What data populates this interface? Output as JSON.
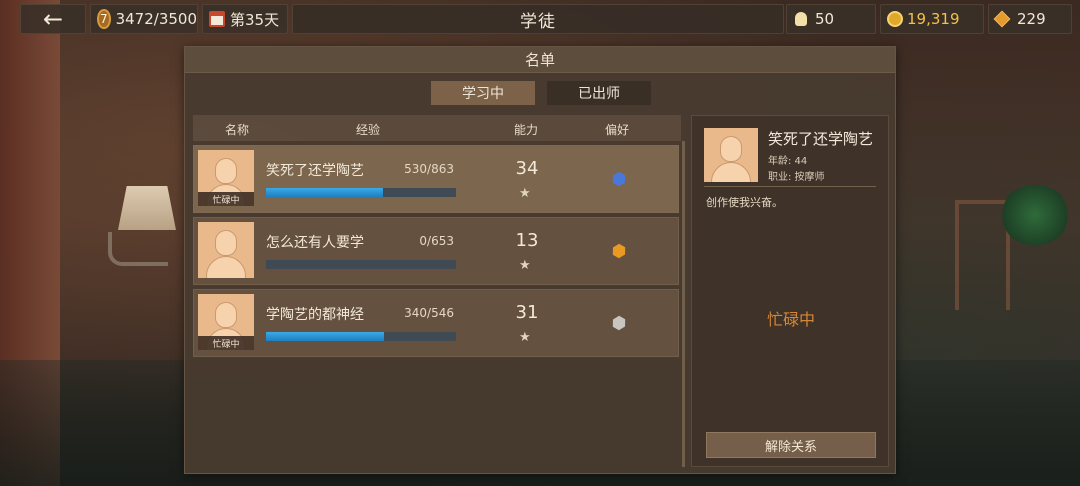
{
  "topbar": {
    "back_icon": "arrow-left-icon",
    "rank_level": "7",
    "rank_progress": "3472/3500",
    "day": "第35天",
    "title": "学徒",
    "ideas": "50",
    "coins": "19,319",
    "blocks": "229"
  },
  "panel": {
    "title": "名单",
    "tabs": [
      {
        "label": "学习中",
        "active": true
      },
      {
        "label": "已出师",
        "active": false
      }
    ],
    "columns": [
      "名称",
      "经验",
      "能力",
      "偏好"
    ]
  },
  "apprentices": [
    {
      "name": "笑死了还学陶艺",
      "exp": "530/863",
      "exp_ratio": 0.614,
      "ability": "34",
      "busy": "忙碌中",
      "pref_icon": "blue-hex-icon",
      "pref_color": "#4a78d8",
      "selected": true
    },
    {
      "name": "怎么还有人要学",
      "exp": "0/653",
      "exp_ratio": 0.0,
      "ability": "13",
      "busy": "",
      "pref_icon": "orange-hex-icon",
      "pref_color": "#e89a22",
      "selected": false
    },
    {
      "name": "学陶艺的都神经",
      "exp": "340/546",
      "exp_ratio": 0.623,
      "ability": "31",
      "busy": "忙碌中",
      "pref_icon": "gray-hex-icon",
      "pref_color": "#c9c6c0",
      "selected": false
    }
  ],
  "detail": {
    "name": "笑死了还学陶艺",
    "age": "年龄: 44",
    "job": "职业: 按摩师",
    "desc": "创作使我兴奋。",
    "status": "忙碌中",
    "release_button": "解除关系"
  }
}
